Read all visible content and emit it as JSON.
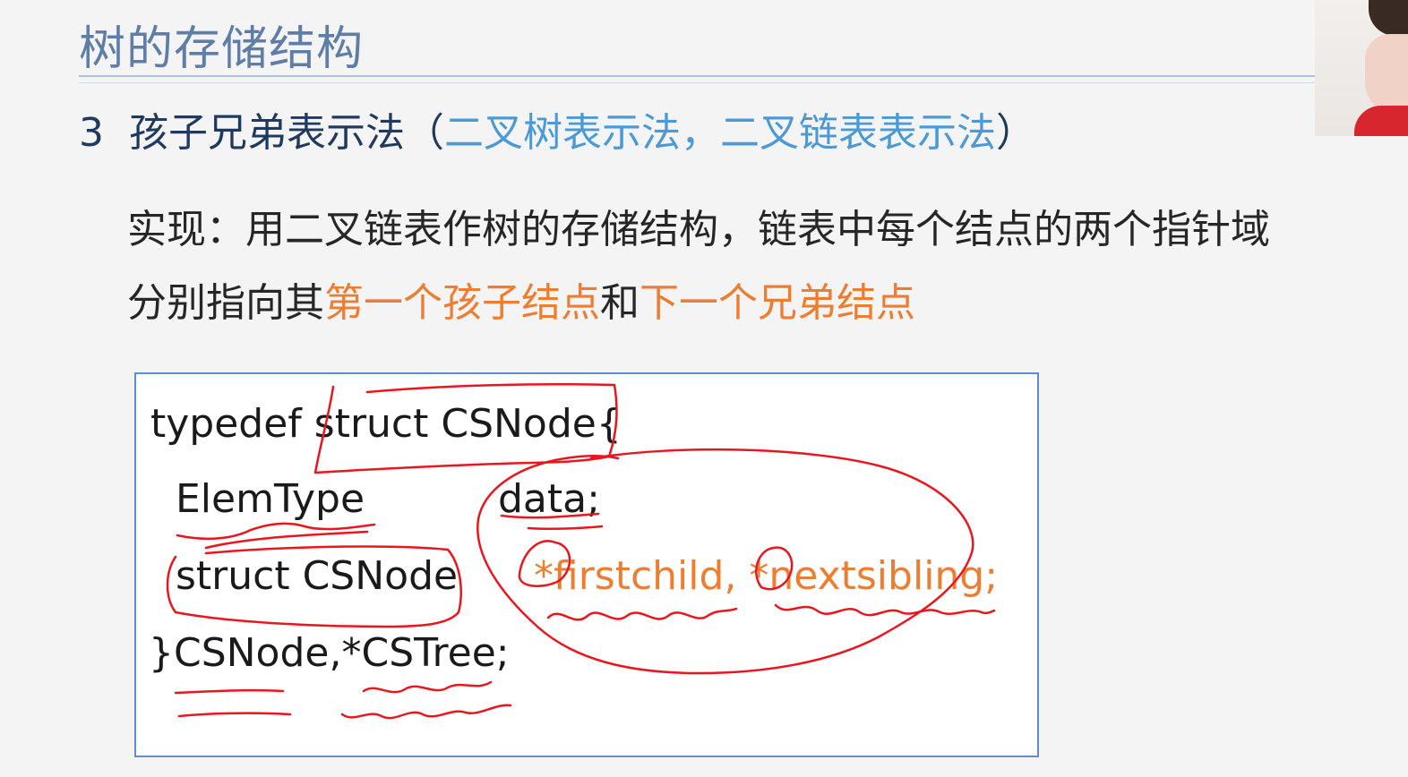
{
  "slide": {
    "title": "树的存储结构",
    "section": {
      "number": "3",
      "text": "孩子兄弟表示法（",
      "highlight": "二叉树表示法，二叉链表表示法",
      "close": "）"
    },
    "paragraph": {
      "line1": "实现：用二叉链表作树的存储结构，链表中每个结点的两个指针域",
      "line2_prefix": "分别指向其",
      "line2_first": "第一个孩子结点",
      "line2_and": "和",
      "line2_second": "下一个兄弟结点"
    },
    "code": {
      "line1": "typedef struct CSNode{",
      "line2_type": "ElemType",
      "line2_field": "data;",
      "line3_type": "struct CSNode",
      "line3_fields": "*firstchild, *nextsibling;",
      "line4": "}CSNode,*CSTree;"
    }
  },
  "colors": {
    "title": "#5e7ea8",
    "section": "#1f3a5e",
    "highlight": "#4b9ad6",
    "orange": "#ed7d31",
    "ink": "#e8161e",
    "box_border": "#5b8fcf"
  }
}
